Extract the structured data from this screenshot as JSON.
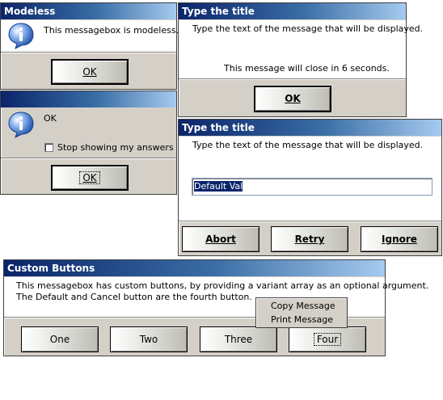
{
  "modeless": {
    "title": "Modeless",
    "message": "This messagebox is modeless.",
    "ok_label": "OK"
  },
  "answers": {
    "title": "",
    "message": "OK",
    "checkbox_label": "Stop showing my answers",
    "checkbox_checked": false,
    "ok_label": "OK"
  },
  "timed": {
    "title": "Type the title",
    "message": "Type the text of the message that will be displayed.",
    "countdown": "This message will close in 6 seconds.",
    "ok_label": "OK"
  },
  "input_dialog": {
    "title": "Type the title",
    "message": "Type the text of the message that will be displayed.",
    "input_value": "Default Val",
    "abort_label": "Abort",
    "retry_label": "Retry",
    "ignore_label": "Ignore"
  },
  "custom": {
    "title": "Custom Buttons",
    "message_line1": "This messagebox has custom buttons, by providing a variant array as an optional argument.",
    "message_line2": "The Default and Cancel button are the fourth button.",
    "buttons": [
      "One",
      "Two",
      "Three",
      "Four"
    ]
  },
  "context_menu": {
    "items": [
      "Copy Message",
      "Print Message"
    ]
  },
  "icons": {
    "info": "information-icon"
  },
  "colors": {
    "title_start": "#0a246a",
    "title_end": "#a6caf0",
    "dialog_face": "#d4d0c8",
    "selection": "#0a246a"
  }
}
